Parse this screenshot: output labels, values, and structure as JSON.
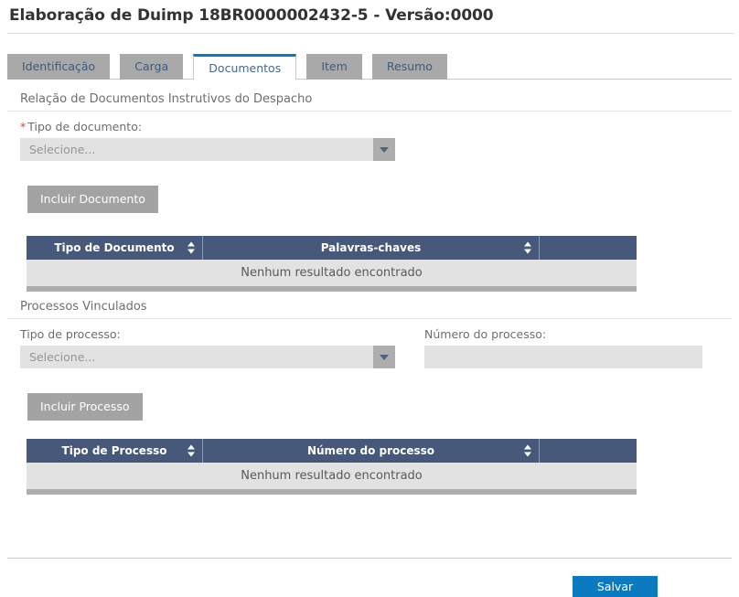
{
  "header": {
    "title": "Elaboração de Duimp 18BR0000002432-5 - Versão:0000"
  },
  "tabs": [
    {
      "label": "Identificação",
      "active": false
    },
    {
      "label": "Carga",
      "active": false
    },
    {
      "label": "Documentos",
      "active": true
    },
    {
      "label": "Item",
      "active": false
    },
    {
      "label": "Resumo",
      "active": false
    }
  ],
  "documents_section": {
    "heading": "Relação de Documentos Instrutivos do Despacho",
    "tipo_documento": {
      "label": "Tipo de documento:",
      "required_marker": "*",
      "value": "Selecione...",
      "options": [
        "Selecione..."
      ]
    },
    "include_button": "Incluir Documento",
    "table": {
      "columns": [
        "Tipo de Documento",
        "Palavras-chaves",
        ""
      ],
      "rows": [],
      "empty_message": "Nenhum resultado encontrado"
    }
  },
  "processes_section": {
    "heading": "Processos Vinculados",
    "tipo_processo": {
      "label": "Tipo de processo:",
      "value": "Selecione...",
      "options": [
        "Selecione..."
      ]
    },
    "numero_processo": {
      "label": "Número do processo:",
      "value": "",
      "placeholder": ""
    },
    "include_button": "Incluir Processo",
    "table": {
      "columns": [
        "Tipo de Processo",
        "Número do processo",
        ""
      ],
      "rows": [],
      "empty_message": "Nenhum resultado encontrado"
    }
  },
  "footer": {
    "save_label": "Salvar"
  },
  "icons": {
    "sort": "sort-updown-icon",
    "dropdown": "chevron-down-icon"
  },
  "colors": {
    "accent": "#0b7abf",
    "table_header": "#46597a",
    "tab_inactive": "#a9a9a9",
    "button_gray": "#a3a3a3",
    "required": "#e03a2f"
  }
}
